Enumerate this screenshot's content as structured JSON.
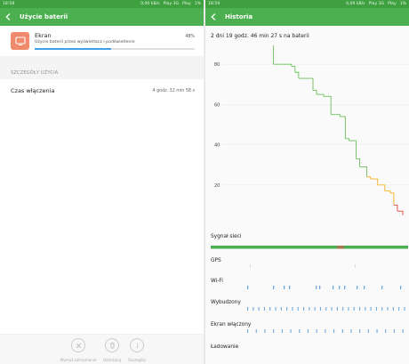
{
  "left": {
    "status": {
      "time": "18:58",
      "net_speed": "0,00 kB/s",
      "carrier1": "Play 3G",
      "carrier2": "Play",
      "battery": "1%"
    },
    "title": "Użycie baterii",
    "app": {
      "name": "Ekran",
      "description": "Użycie baterii przez wyświetlacz i podświetlenie",
      "percent_label": "48%",
      "percent": 48
    },
    "section_label": "SZCZEGÓŁY UŻYCIA",
    "usage_row": {
      "label": "Czas włączenia",
      "value": "4 godz. 32 min 58 s"
    },
    "actions": [
      {
        "label": "Wymuś zatrzymanie",
        "icon": "close-icon"
      },
      {
        "label": "Odinstaluj",
        "icon": "trash-icon"
      },
      {
        "label": "Szczegóły",
        "icon": "info-icon"
      }
    ]
  },
  "right": {
    "status": {
      "time": "18:59",
      "net_speed": "0,09 kB/s",
      "carrier1": "Play 3G",
      "carrier2": "Play",
      "battery": "1%"
    },
    "title": "Historia",
    "summary": "2 dni 19 godz. 46 min 27 s na baterii",
    "y_tick_labels": [
      "100",
      "80",
      "60",
      "40",
      "20"
    ],
    "tracks": [
      {
        "label": "Sygnał sieci",
        "color": "#4caf50"
      },
      {
        "label": "GPS",
        "color": "#c9d4dc"
      },
      {
        "label": "Wi-Fi",
        "color": "#6fa8dc"
      },
      {
        "label": "Wybudzony",
        "color": "#6fa8dc"
      },
      {
        "label": "Ekran włączony",
        "color": "#6fa8dc"
      },
      {
        "label": "Ładowanie",
        "color": "#6fa8dc"
      }
    ]
  },
  "chart_data": {
    "type": "line",
    "title": "",
    "xlabel": "",
    "ylabel": "",
    "ylim": [
      0,
      100
    ],
    "yticks": [
      20,
      40,
      60,
      80,
      100
    ],
    "grid": true,
    "x": [
      0,
      0.21,
      0.24,
      0.255,
      0.28,
      0.38,
      0.4,
      0.42,
      0.5,
      0.52,
      0.56,
      0.6,
      0.65,
      0.68,
      0.7,
      0.74,
      0.76,
      0.8,
      0.82,
      0.86,
      0.9,
      0.93,
      0.95,
      0.97,
      1.0
    ],
    "values": [
      100,
      99,
      98,
      93,
      80,
      79,
      76,
      73,
      67,
      65,
      64,
      55,
      54,
      43,
      42,
      33,
      29,
      24,
      23,
      20,
      17,
      16,
      10,
      7,
      5
    ],
    "segment_colors": {
      "high": "#6cbf5a",
      "mid": "#f5b323",
      "low": "#e0433c"
    }
  }
}
